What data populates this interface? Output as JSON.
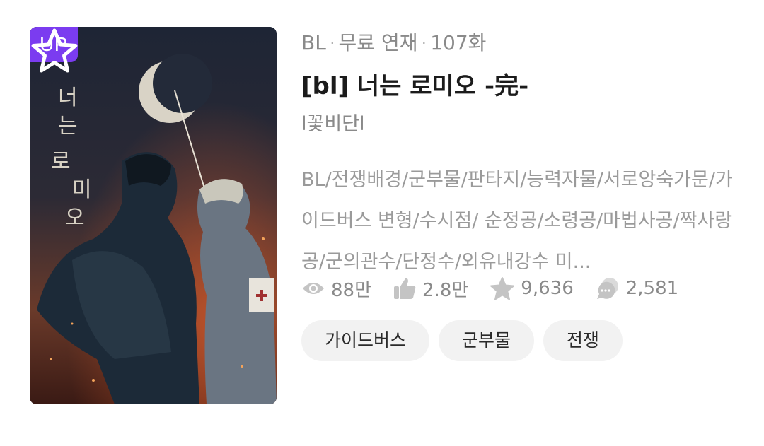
{
  "badge": "UP",
  "cover": {
    "title_art": "너는 로미오"
  },
  "meta": {
    "genre": "BL",
    "separator": "·",
    "status": "무료 연재",
    "episodes": "107화"
  },
  "title": "[bl] 너는 로미오 -完-",
  "author": "l꽃비단l",
  "description_tags": "BL/전쟁배경/군부물/판타지/능력자물/서로앙숙가문/가이드버스 변형/수시점/ 순정공/소령공/마법사공/짝사랑공/군의관수/단정수/외유내강수 미...",
  "stats": {
    "views": "88만",
    "likes": "2.8만",
    "rating": "9,636",
    "comments": "2,581"
  },
  "chips": [
    "가이드버스",
    "군부물",
    "전쟁"
  ],
  "colors": {
    "badge_bg": "#7b3cf0",
    "chip_bg": "#f2f2f2",
    "meta_text": "#8a8a8a",
    "icon": "#c4c4c4"
  },
  "icons": [
    "eye-icon",
    "thumbs-up-icon",
    "star-icon",
    "comment-icon",
    "favorite-star-icon"
  ]
}
